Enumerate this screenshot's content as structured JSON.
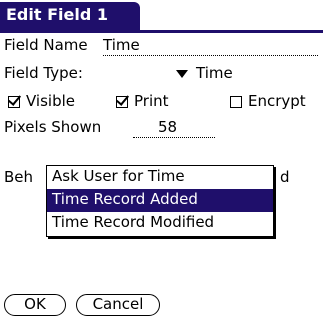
{
  "title": "Edit Field 1",
  "field_name": {
    "label": "Field Name",
    "value": "Time"
  },
  "field_type": {
    "label": "Field Type:",
    "value": "Time"
  },
  "options": [
    {
      "label": "Visible",
      "checked": true
    },
    {
      "label": "Print",
      "checked": true
    },
    {
      "label": "Encrypt",
      "checked": false
    }
  ],
  "pixels_shown": {
    "label": "Pixels Shown",
    "value": "58"
  },
  "behavior": {
    "label_left": "Beh",
    "label_right": "d"
  },
  "popup": {
    "items": [
      "Ask User for Time",
      "Time Record Added",
      "Time Record Modified"
    ],
    "selected_index": 1
  },
  "buttons": {
    "ok": "OK",
    "cancel": "Cancel"
  },
  "colors": {
    "accent": "#1f0f6b"
  }
}
